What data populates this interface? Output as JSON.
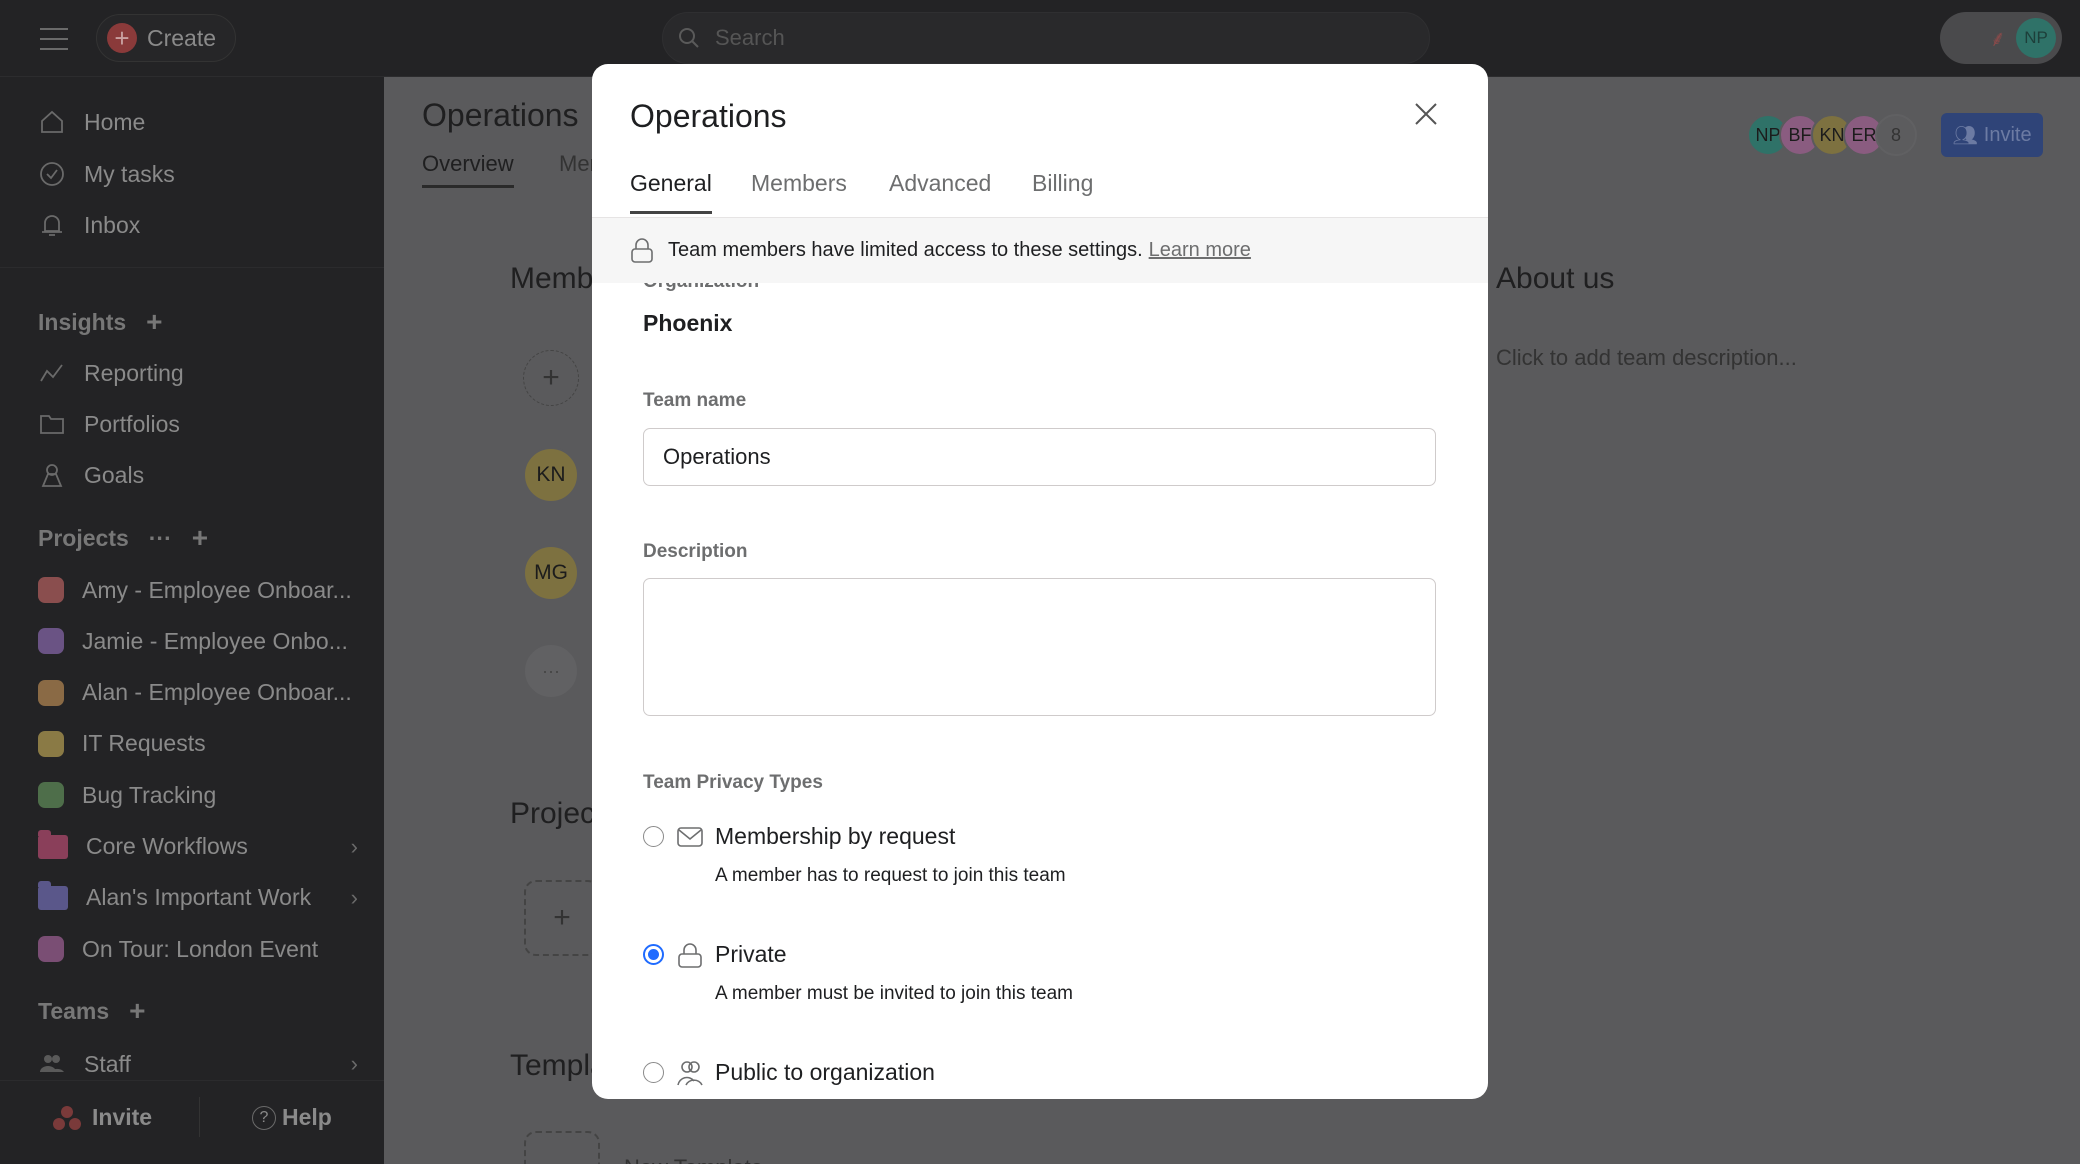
{
  "topbar": {
    "create_label": "Create",
    "search_placeholder": "Search",
    "user_initials": "NP"
  },
  "sidebar": {
    "nav": [
      {
        "label": "Home",
        "icon": "home-icon"
      },
      {
        "label": "My tasks",
        "icon": "check-circle-icon"
      },
      {
        "label": "Inbox",
        "icon": "bell-icon"
      }
    ],
    "insights": {
      "title": "Insights",
      "items": [
        {
          "label": "Reporting",
          "icon": "chart-line-icon"
        },
        {
          "label": "Portfolios",
          "icon": "folder-icon"
        },
        {
          "label": "Goals",
          "icon": "goal-icon"
        }
      ]
    },
    "projects": {
      "title": "Projects",
      "items": [
        {
          "label": "Amy - Employee Onboar...",
          "color": "#8a4e4e",
          "type": "project"
        },
        {
          "label": "Jamie - Employee Onbo...",
          "color": "#6a5384",
          "type": "project"
        },
        {
          "label": "Alan - Employee Onboar...",
          "color": "#8a6a45",
          "type": "project"
        },
        {
          "label": "IT Requests",
          "color": "#8a7a45",
          "type": "project"
        },
        {
          "label": "Bug Tracking",
          "color": "#4e6e4a",
          "type": "project"
        },
        {
          "label": "Core Workflows",
          "color": "#8a3f5a",
          "type": "portfolio"
        },
        {
          "label": "Alan's Important Work",
          "color": "#5a578a",
          "type": "portfolio"
        },
        {
          "label": "On Tour: London Event",
          "color": "#7a4e74",
          "type": "project"
        }
      ]
    },
    "teams": {
      "title": "Teams",
      "items": [
        {
          "label": "Staff",
          "icon": "team-icon"
        }
      ]
    },
    "footer": {
      "invite_label": "Invite",
      "help_label": "Help"
    }
  },
  "page": {
    "title": "Operations",
    "tabs": [
      "Overview",
      "Members"
    ],
    "members_heading": "Members",
    "member_avatars": [
      {
        "initials": "KN",
        "color": "#7d7140"
      },
      {
        "initials": "MG",
        "color": "#7d7140"
      }
    ],
    "projects_heading": "Projects",
    "templates_heading": "Templates",
    "new_template": "New Template",
    "about_heading": "About us",
    "about_placeholder": "Click to add team description...",
    "header_avatars": [
      {
        "initials": "NP",
        "color": "#2f7268"
      },
      {
        "initials": "BF",
        "color": "#8a5c80"
      },
      {
        "initials": "KN",
        "color": "#7d7140"
      },
      {
        "initials": "ER",
        "color": "#8a5c80"
      }
    ],
    "member_count": "8",
    "invite_label": "Invite"
  },
  "modal": {
    "title": "Operations",
    "tabs": [
      "General",
      "Members",
      "Advanced",
      "Billing"
    ],
    "active_tab": "General",
    "banner": {
      "text": "Team members have limited access to these settings.",
      "link": "Learn more"
    },
    "organization_label": "Organization",
    "organization_value": "Phoenix",
    "team_name_label": "Team name",
    "team_name_value": "Operations",
    "description_label": "Description",
    "description_value": "",
    "privacy_label": "Team Privacy Types",
    "privacy_options": [
      {
        "label": "Membership by request",
        "desc": "A member has to request to join this team",
        "icon": "mail-icon",
        "selected": false
      },
      {
        "label": "Private",
        "desc": "A member must be invited to join this team",
        "icon": "lock-icon",
        "selected": true
      },
      {
        "label": "Public to organization",
        "desc": "",
        "icon": "people-icon",
        "selected": false
      }
    ],
    "accent": "#1f6bff"
  }
}
